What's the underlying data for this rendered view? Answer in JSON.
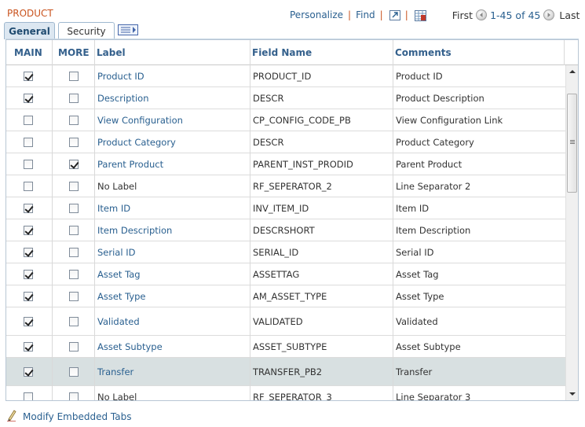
{
  "grid": {
    "title": "PRODUCT",
    "nav": {
      "personalize": "Personalize",
      "find": "Find",
      "first": "First",
      "count": "1-45 of 45",
      "last": "Last"
    },
    "tabs": [
      {
        "label": "General"
      },
      {
        "label": "Security"
      }
    ],
    "columns": {
      "main": "MAIN",
      "more": "MORE",
      "label": "Label",
      "field": "Field Name",
      "comments": "Comments"
    },
    "rows": [
      {
        "main": true,
        "more": false,
        "label": "Product ID",
        "link": true,
        "field": "PRODUCT_ID",
        "comments": "Product ID"
      },
      {
        "main": true,
        "more": false,
        "label": "Description",
        "link": true,
        "field": "DESCR",
        "comments": "Product Description"
      },
      {
        "main": false,
        "more": false,
        "label": "View Configuration",
        "link": true,
        "field": "CP_CONFIG_CODE_PB",
        "comments": "View Configuration Link"
      },
      {
        "main": false,
        "more": false,
        "label": "Product Category",
        "link": true,
        "field": "DESCR",
        "comments": "Product Category"
      },
      {
        "main": false,
        "more": true,
        "label": "Parent Product",
        "link": true,
        "field": "PARENT_INST_PRODID",
        "comments": "Parent Product"
      },
      {
        "main": false,
        "more": false,
        "label": "No Label",
        "link": false,
        "field": "RF_SEPERATOR_2",
        "comments": "Line Separator 2"
      },
      {
        "main": true,
        "more": false,
        "label": "Item ID",
        "link": true,
        "field": "INV_ITEM_ID",
        "comments": "Item ID"
      },
      {
        "main": true,
        "more": false,
        "label": "Item Description",
        "link": true,
        "field": "DESCRSHORT",
        "comments": "Item Description"
      },
      {
        "main": true,
        "more": false,
        "label": "Serial ID",
        "link": true,
        "field": "SERIAL_ID",
        "comments": "Serial ID"
      },
      {
        "main": true,
        "more": false,
        "label": "Asset Tag",
        "link": true,
        "field": "ASSETTAG",
        "comments": "Asset Tag"
      },
      {
        "main": true,
        "more": false,
        "label": "Asset Type",
        "link": true,
        "field": "AM_ASSET_TYPE",
        "comments": "Asset Type"
      },
      {
        "main": true,
        "more": false,
        "label": "Validated",
        "link": true,
        "field": "VALIDATED",
        "comments": "Validated"
      },
      {
        "main": true,
        "more": false,
        "label": "Asset Subtype",
        "link": true,
        "field": "ASSET_SUBTYPE",
        "comments": "Asset Subtype"
      },
      {
        "main": true,
        "more": false,
        "label": "Transfer",
        "link": true,
        "field": "TRANSFER_PB2",
        "comments": "Transfer",
        "selected": true
      },
      {
        "main": false,
        "more": false,
        "label": "No Label",
        "link": false,
        "field": "RF_SEPERATOR_3",
        "comments": "Line Separator 3"
      }
    ]
  },
  "footer": {
    "modify_link": "Modify Embedded Tabs"
  },
  "colors": {
    "title": "#c9531e",
    "link": "#2a6090",
    "header": "#34608c",
    "selected_row": "#d8e0e1"
  },
  "icons": {
    "zoom": "zoom-grid-icon",
    "download": "download-excel-icon",
    "prev": "previous-arrow-icon",
    "next": "next-arrow-icon",
    "expand_tabs": "show-all-columns-icon",
    "pencil": "pencil-icon"
  }
}
